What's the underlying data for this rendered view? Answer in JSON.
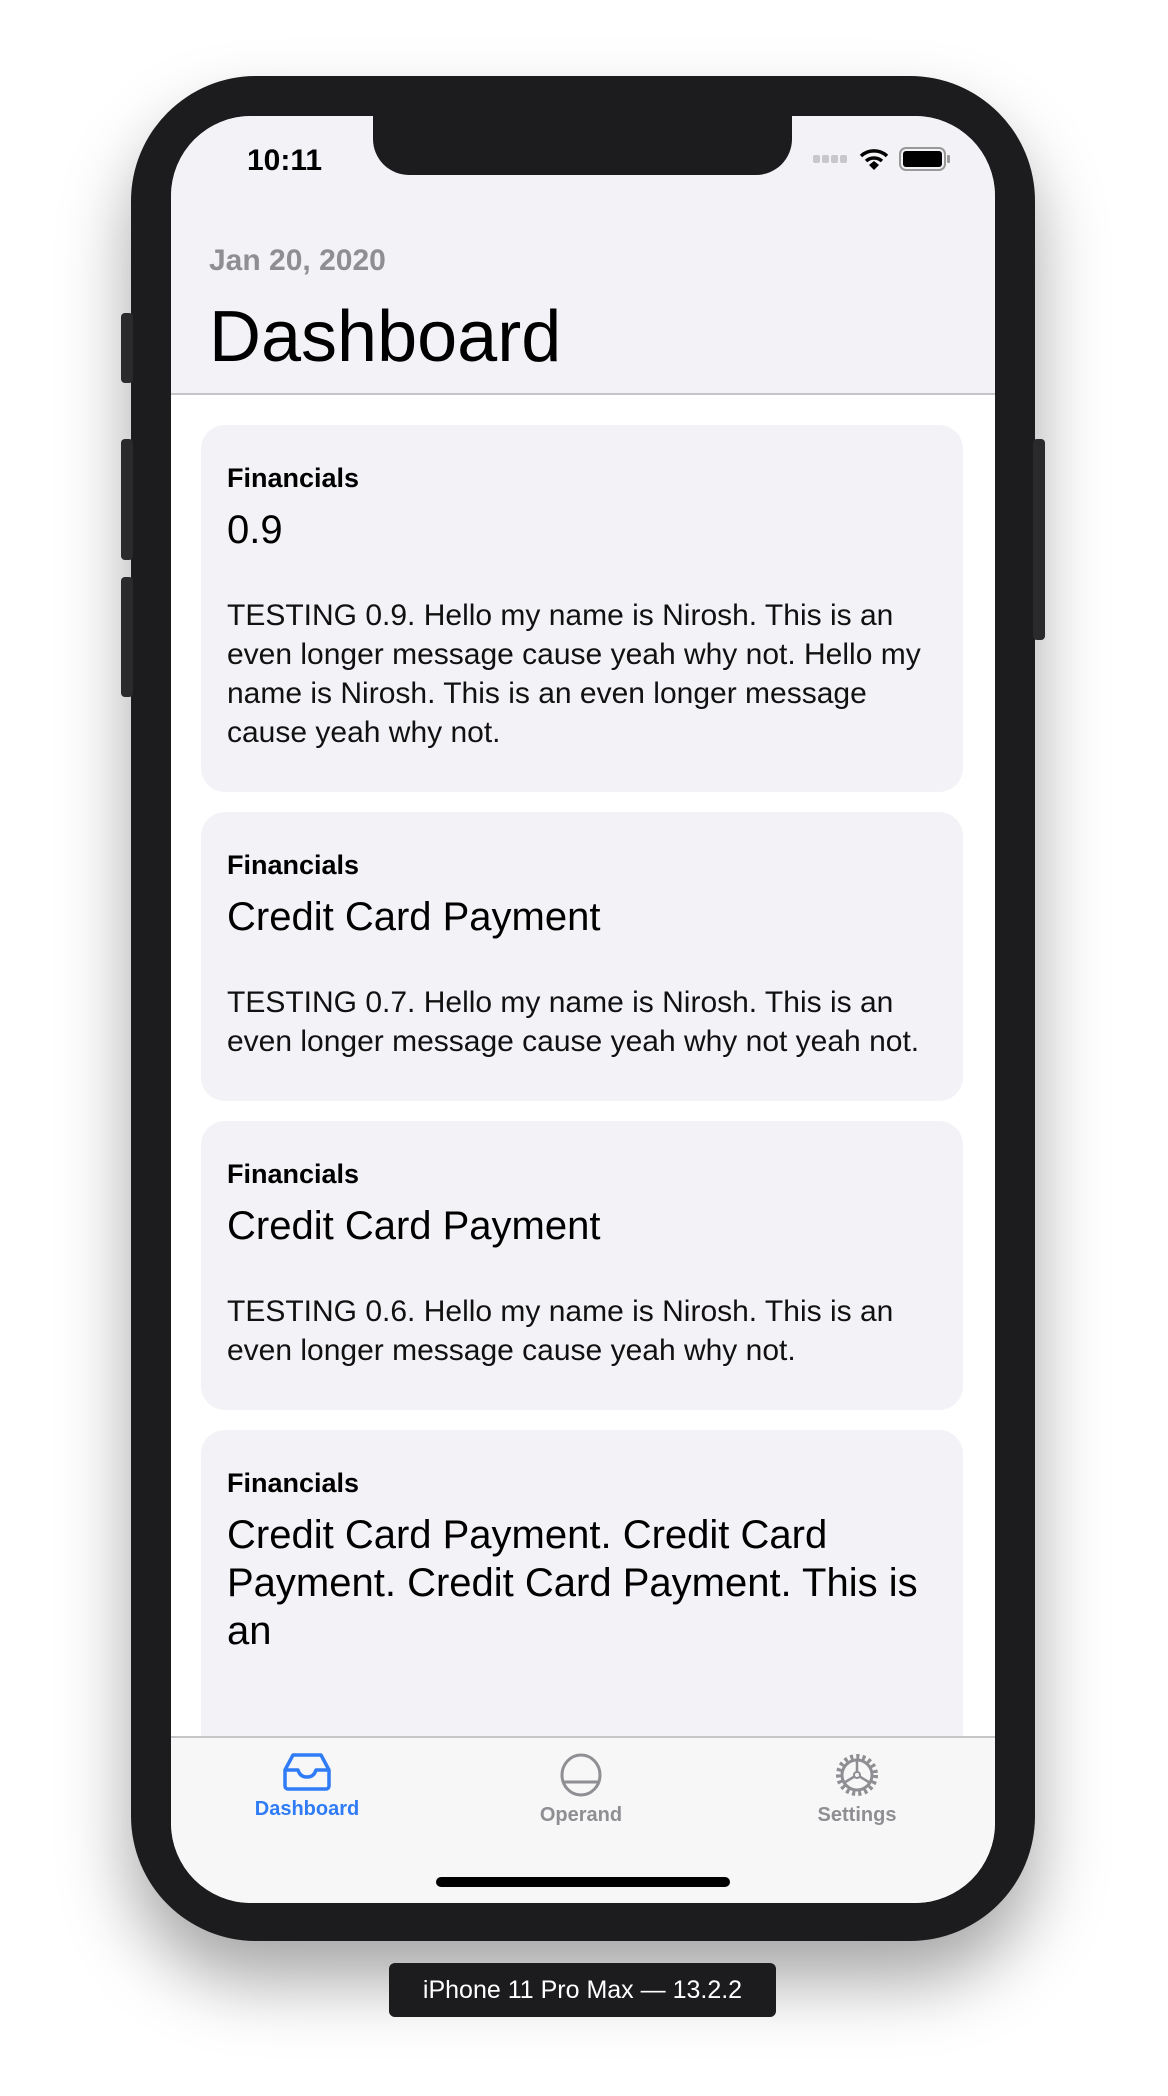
{
  "status_bar": {
    "time": "10:11"
  },
  "header": {
    "date": "Jan 20, 2020",
    "title": "Dashboard"
  },
  "cards": [
    {
      "category": "Financials",
      "title": "0.9",
      "body": "TESTING 0.9. Hello my name is Nirosh. This is an even longer message cause yeah why not. Hello my name is Nirosh. This is an even longer message cause yeah why not."
    },
    {
      "category": "Financials",
      "title": "Credit Card Payment",
      "body": "TESTING 0.7. Hello my name is Nirosh. This is an even longer message cause yeah why not yeah not."
    },
    {
      "category": "Financials",
      "title": "Credit Card Payment",
      "body": "TESTING 0.6. Hello my name is Nirosh. This is an even longer message cause yeah why not."
    },
    {
      "category": "Financials",
      "title": "Credit Card Payment. Credit Card Payment. Credit Card Payment. This is an"
    }
  ],
  "tabs": [
    {
      "label": "Dashboard",
      "icon": "tray-icon",
      "active": true
    },
    {
      "label": "Operand",
      "icon": "circle-half-icon",
      "active": false
    },
    {
      "label": "Settings",
      "icon": "gear-icon",
      "active": false
    }
  ],
  "colors": {
    "accent": "#2f7cf6",
    "inactive": "#8e8e93"
  },
  "device_label": "iPhone 11 Pro Max — 13.2.2"
}
